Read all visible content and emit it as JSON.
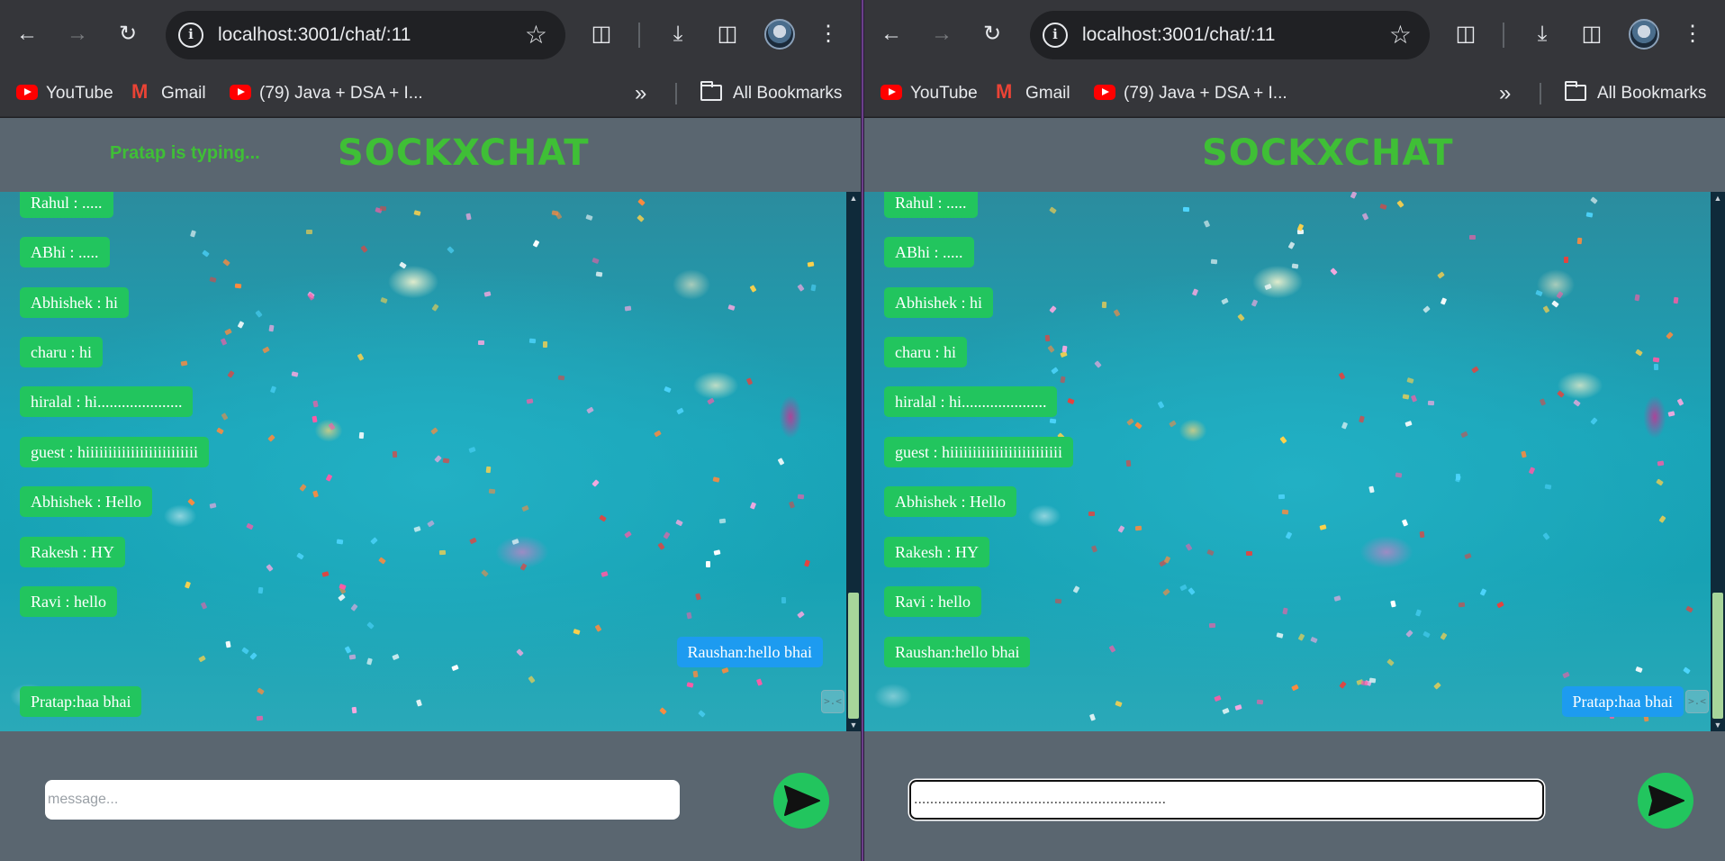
{
  "browser": {
    "url": "localhost:3001/chat/:11",
    "bookmarks": [
      {
        "label": "YouTube",
        "icon": "youtube-icon"
      },
      {
        "label": "Gmail",
        "icon": "gmail-icon"
      },
      {
        "label": "(79) Java + DSA + I...",
        "icon": "youtube-icon"
      }
    ],
    "more_bookmarks": "»",
    "all_bookmarks_label": "All Bookmarks"
  },
  "app": {
    "brand": "SOCKXCHAT",
    "colors": {
      "brand": "#3fbf36",
      "incoming": "#22c55e",
      "outgoing": "#1d9bf0",
      "send": "#22c55e"
    }
  },
  "left_window": {
    "typing_status": "Pratap is typing...",
    "messages": [
      {
        "text": "Rahul : .....",
        "side": "left"
      },
      {
        "text": "ABhi : .....",
        "side": "left"
      },
      {
        "text": "Abhishek : hi",
        "side": "left"
      },
      {
        "text": "charu : hi",
        "side": "left"
      },
      {
        "text": "hiralal : hi.....................",
        "side": "left"
      },
      {
        "text": "guest : hiiiiiiiiiiiiiiiiiiiiiiiii",
        "side": "left"
      },
      {
        "text": "Abhishek : Hello",
        "side": "left"
      },
      {
        "text": "Rakesh : HY",
        "side": "left"
      },
      {
        "text": "Ravi : hello",
        "side": "left"
      },
      {
        "text": "Raushan:hello bhai",
        "side": "right"
      },
      {
        "text": "Pratap:haa bhai",
        "side": "left"
      }
    ],
    "input": {
      "placeholder": "message...",
      "value": ""
    }
  },
  "right_window": {
    "typing_status": "",
    "messages": [
      {
        "text": "Rahul : .....",
        "side": "left"
      },
      {
        "text": "ABhi : .....",
        "side": "left"
      },
      {
        "text": "Abhishek : hi",
        "side": "left"
      },
      {
        "text": "charu : hi",
        "side": "left"
      },
      {
        "text": "hiralal : hi.....................",
        "side": "left"
      },
      {
        "text": "guest : hiiiiiiiiiiiiiiiiiiiiiiiii",
        "side": "left"
      },
      {
        "text": "Abhishek : Hello",
        "side": "left"
      },
      {
        "text": "Rakesh : HY",
        "side": "left"
      },
      {
        "text": "Ravi : hello",
        "side": "left"
      },
      {
        "text": "Raushan:hello bhai",
        "side": "left"
      },
      {
        "text": "Pratap:haa bhai",
        "side": "right"
      }
    ],
    "input": {
      "placeholder": "message...",
      "value": "..............................................................."
    }
  },
  "emoji_button": ">.<"
}
